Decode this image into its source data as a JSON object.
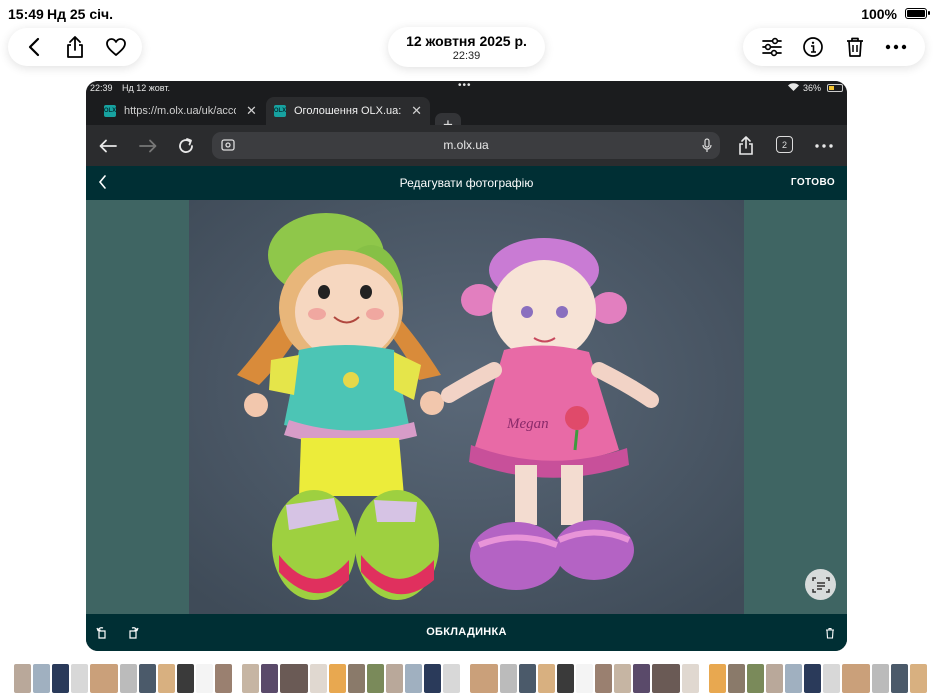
{
  "status_bar": {
    "time": "15:49",
    "date": "Нд 25 січ.",
    "battery": "100%"
  },
  "photos_header": {
    "back_icon": "chevron-left-icon",
    "share_icon": "share-icon",
    "favorite_icon": "heart-icon",
    "date_title": "12 жовтня 2025 р.",
    "time_subtitle": "22:39",
    "adjust_icon": "sliders-icon",
    "info_icon": "info-icon",
    "delete_icon": "trash-icon",
    "more_icon": "ellipsis-icon"
  },
  "screenshot": {
    "ipad_status": {
      "time": "22:39",
      "date": "Нд 12 жовт.",
      "battery": "36%"
    },
    "browser": {
      "tabs": [
        {
          "label": "https://m.olx.ua/uk/acco",
          "favicon": "OLX"
        },
        {
          "label": "Оголошення OLX.ua: се",
          "favicon": "OLX",
          "active": true
        }
      ],
      "url": "m.olx.ua",
      "tab_count": "2"
    },
    "editor": {
      "title": "Редагувати фотографію",
      "done_label": "ГОТОВО",
      "cover_label": "ОБКЛАДИНКА",
      "doll_name_text": "Megan"
    }
  },
  "colors": {
    "olx_dark": "#002f34",
    "editor_bg": "#3f6563",
    "browser_toolbar": "#2b2c2e"
  }
}
